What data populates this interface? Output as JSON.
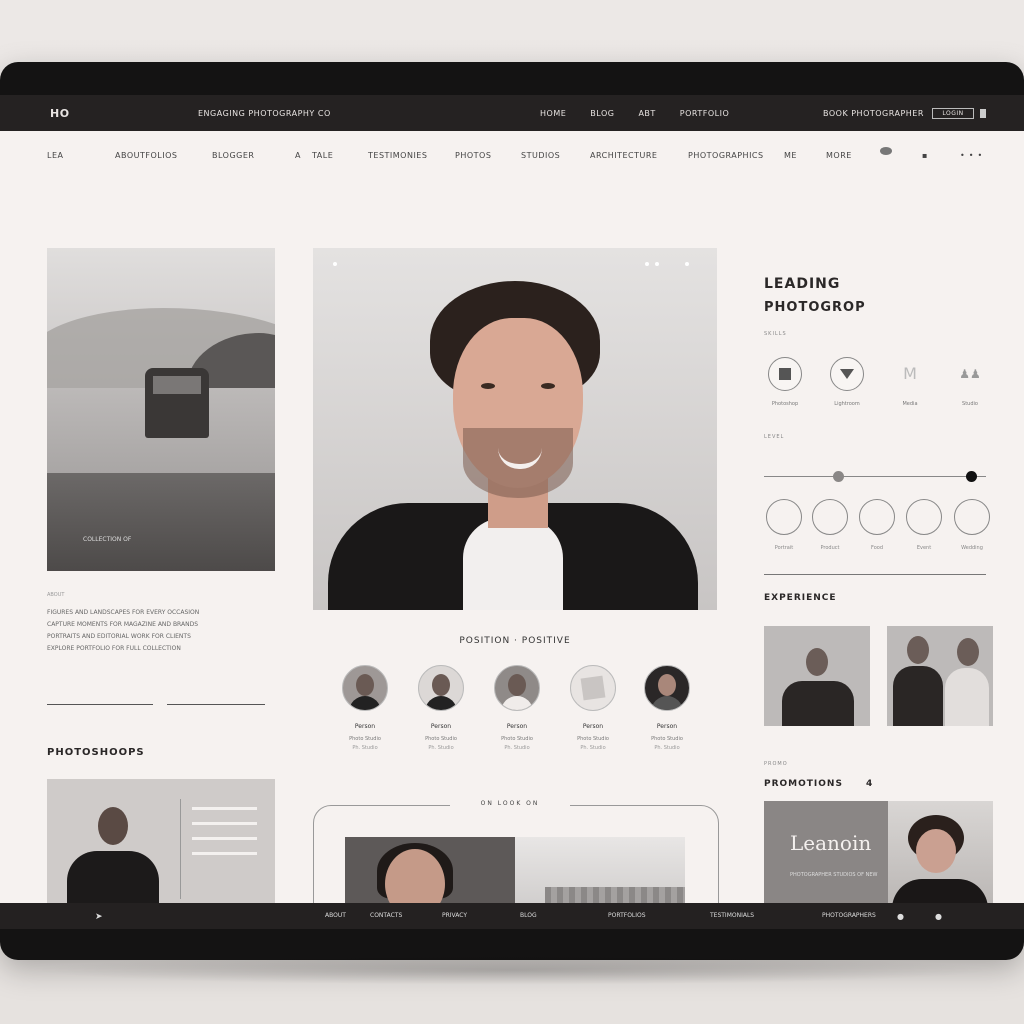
{
  "topbar": {
    "logo": "HO",
    "tagline": "ENGAGING PHOTOGRAPHY CO",
    "nav": [
      "HOME",
      "BLOG",
      "ABT",
      "PORTFOLIO"
    ],
    "cta": "BOOK PHOTOGRAPHER",
    "box": "LOGIN"
  },
  "subnav": {
    "items": [
      "LEA",
      "ABOUTFOLIOS",
      "BLOGGER",
      "A",
      "TALE",
      "TESTIMONIES",
      "PHOTOS",
      "STUDIOS",
      "ARCHITECTURE",
      "PHOTOGRAPHICS",
      "ME",
      "MORE"
    ]
  },
  "left": {
    "caption": "COLLECTION OF",
    "intro": "ABOUT",
    "text_lines": [
      "FIGURES AND LANDSCAPES FOR EVERY OCCASION",
      "CAPTURE MOMENTS FOR MAGAZINE AND BRANDS",
      "PORTRAITS AND EDITORIAL WORK FOR CLIENTS",
      "EXPLORE PORTFOLIO FOR FULL COLLECTION"
    ],
    "section_title": "PHOTOSHOOPS"
  },
  "center": {
    "title": "POSITION · POSITIVE",
    "team": [
      {
        "name": "Person",
        "role": "Photo Studio",
        "sub": "Ph. Studio"
      },
      {
        "name": "Person",
        "role": "Photo Studio",
        "sub": "Ph. Studio"
      },
      {
        "name": "Person",
        "role": "Photo Studio",
        "sub": "Ph. Studio"
      },
      {
        "name": "Person",
        "role": "Photo Studio",
        "sub": "Ph. Studio"
      },
      {
        "name": "Person",
        "role": "Photo Studio",
        "sub": "Ph. Studio"
      }
    ],
    "bottom_label": "ON LOOK ON"
  },
  "right": {
    "title_line1": "LEADING",
    "title_line2": "PHOTOGROP",
    "small_label": "SKILLS",
    "skills": [
      "Photoshop",
      "Lightroom",
      "Media",
      "Studio"
    ],
    "mid_label": "LEVEL",
    "circles": [
      "Portrait",
      "Product",
      "Food",
      "Event",
      "Wedding"
    ],
    "experience_title": "EXPERIENCE",
    "promo_small": "PROMO",
    "promotions_title": "PROMOTIONS",
    "promotions_count": "4",
    "promo_text": "Leanoin",
    "promo_sub": "PHOTOGRAPHER STUDIOS OF NEW"
  },
  "bottombar": {
    "items": [
      "ABOUT",
      "CONTACTS",
      "PRIVACY",
      "BLOG",
      "PORTFOLIOS",
      "TESTIMONIALS",
      "PHOTOGRAPHERS"
    ]
  }
}
